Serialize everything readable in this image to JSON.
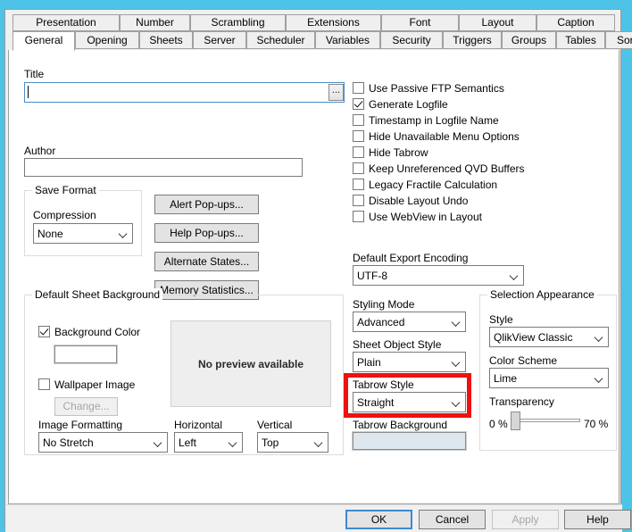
{
  "window": {
    "chrome_color": "#4ec3e8"
  },
  "tabs": {
    "row1": [
      {
        "label": "Presentation"
      },
      {
        "label": "Number"
      },
      {
        "label": "Scrambling"
      },
      {
        "label": "Extensions"
      },
      {
        "label": "Font"
      },
      {
        "label": "Layout"
      },
      {
        "label": "Caption"
      }
    ],
    "row2": [
      {
        "label": "General",
        "active": true
      },
      {
        "label": "Opening"
      },
      {
        "label": "Sheets"
      },
      {
        "label": "Server"
      },
      {
        "label": "Scheduler"
      },
      {
        "label": "Variables"
      },
      {
        "label": "Security"
      },
      {
        "label": "Triggers"
      },
      {
        "label": "Groups"
      },
      {
        "label": "Tables"
      },
      {
        "label": "Sort"
      }
    ]
  },
  "general": {
    "title_label": "Title",
    "title_value": "",
    "title_browse_label": "...",
    "author_label": "Author",
    "author_value": "",
    "save_format": {
      "group_label": "Save Format",
      "compression_label": "Compression",
      "compression_value": "None"
    },
    "buttons": [
      {
        "label": "Alert Pop-ups..."
      },
      {
        "label": "Help Pop-ups..."
      },
      {
        "label": "Alternate States..."
      },
      {
        "label": "Memory Statistics..."
      }
    ],
    "checkboxes": [
      {
        "label": "Use Passive FTP Semantics",
        "checked": false
      },
      {
        "label": "Generate Logfile",
        "checked": true
      },
      {
        "label": "Timestamp in Logfile Name",
        "checked": false
      },
      {
        "label": "Hide Unavailable Menu Options",
        "checked": false
      },
      {
        "label": "Hide Tabrow",
        "checked": false
      },
      {
        "label": "Keep Unreferenced QVD Buffers",
        "checked": false
      },
      {
        "label": "Legacy Fractile Calculation",
        "checked": false
      },
      {
        "label": "Disable Layout Undo",
        "checked": false
      },
      {
        "label": "Use WebView in Layout",
        "checked": false
      }
    ],
    "export_encoding_label": "Default Export Encoding",
    "export_encoding_value": "UTF-8"
  },
  "sheet_background": {
    "group_label": "Default Sheet Background",
    "background_color_label": "Background Color",
    "background_color_checked": true,
    "background_color_swatch": "#ffffff",
    "wallpaper_label": "Wallpaper Image",
    "wallpaper_checked": false,
    "change_button_label": "Change...",
    "change_button_disabled": true,
    "preview_text": "No preview available",
    "image_formatting_label": "Image Formatting",
    "image_formatting_value": "No Stretch",
    "horizontal_label": "Horizontal",
    "horizontal_value": "Left",
    "vertical_label": "Vertical",
    "vertical_value": "Top"
  },
  "styling": {
    "styling_mode_label": "Styling Mode",
    "styling_mode_value": "Advanced",
    "sheet_object_style_label": "Sheet Object Style",
    "sheet_object_style_value": "Plain",
    "tabrow_style_label": "Tabrow Style",
    "tabrow_style_value": "Straight",
    "tabrow_background_label": "Tabrow Background",
    "tabrow_background_swatch": "#dfe7ee",
    "highlight_color": "#ee1111"
  },
  "selection_appearance": {
    "group_label": "Selection Appearance",
    "style_label": "Style",
    "style_value": "QlikView Classic",
    "color_scheme_label": "Color Scheme",
    "color_scheme_value": "Lime",
    "transparency_label": "Transparency",
    "transparency_min": "0 %",
    "transparency_max": "70 %",
    "transparency_position": 0
  },
  "footer": {
    "ok_label": "OK",
    "cancel_label": "Cancel",
    "apply_label": "Apply",
    "apply_disabled": true,
    "help_label": "Help"
  }
}
